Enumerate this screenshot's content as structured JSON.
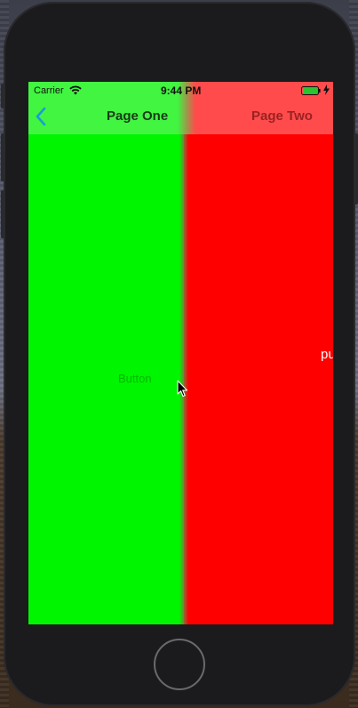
{
  "status_bar": {
    "carrier": "Carrier",
    "time": "9:44 PM",
    "wifi_icon": "wifi-icon",
    "battery_icon": "battery-icon",
    "charging_icon": "charging-bolt-icon"
  },
  "nav": {
    "back_icon": "chevron-left-icon",
    "page_one_title": "Page One",
    "page_two_title": "Page Two"
  },
  "page_one": {
    "button_label": "Button",
    "background": "#00f500"
  },
  "page_two": {
    "push_label": "pu",
    "background": "#ff0000"
  },
  "colors": {
    "green_nav": "#41f541",
    "red_nav": "#ff4b4b",
    "back_tint": "#1a9cd8"
  }
}
